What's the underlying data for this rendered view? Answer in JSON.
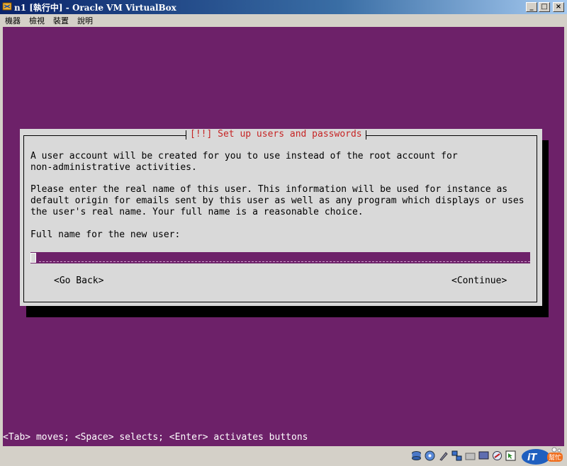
{
  "window": {
    "title": "n1 [執行中] - Oracle VM VirtualBox",
    "controls": [
      "_",
      "□",
      "×"
    ]
  },
  "menu": [
    "機器",
    "檢視",
    "裝置",
    "說明"
  ],
  "dialog": {
    "title": "[!!] Set up users and passwords",
    "paragraph1": "A user account will be created for you to use instead of the root account for\nnon-administrative activities.",
    "paragraph2": "Please enter the real name of this user. This information will be used for instance as\ndefault origin for emails sent by this user as well as any program which displays or uses\nthe user's real name. Your full name is a reasonable choice.",
    "prompt": "Full name for the new user:",
    "input_value": "",
    "back_label": "<Go Back>",
    "continue_label": "<Continue>"
  },
  "hint": "<Tab> moves; <Space> selects; <Enter> activates buttons",
  "statusbar": {
    "icons": [
      "disk-icon",
      "cd-icon",
      "usb-icon",
      "network-icon",
      "folder-icon",
      "display-icon",
      "capture-icon",
      "mouse-icon"
    ],
    "watermark": "iT邦幫忙"
  },
  "colors": {
    "console_bg": "#6d2169",
    "dialog_bg": "#d9d9d9",
    "title_red": "#c62424"
  }
}
